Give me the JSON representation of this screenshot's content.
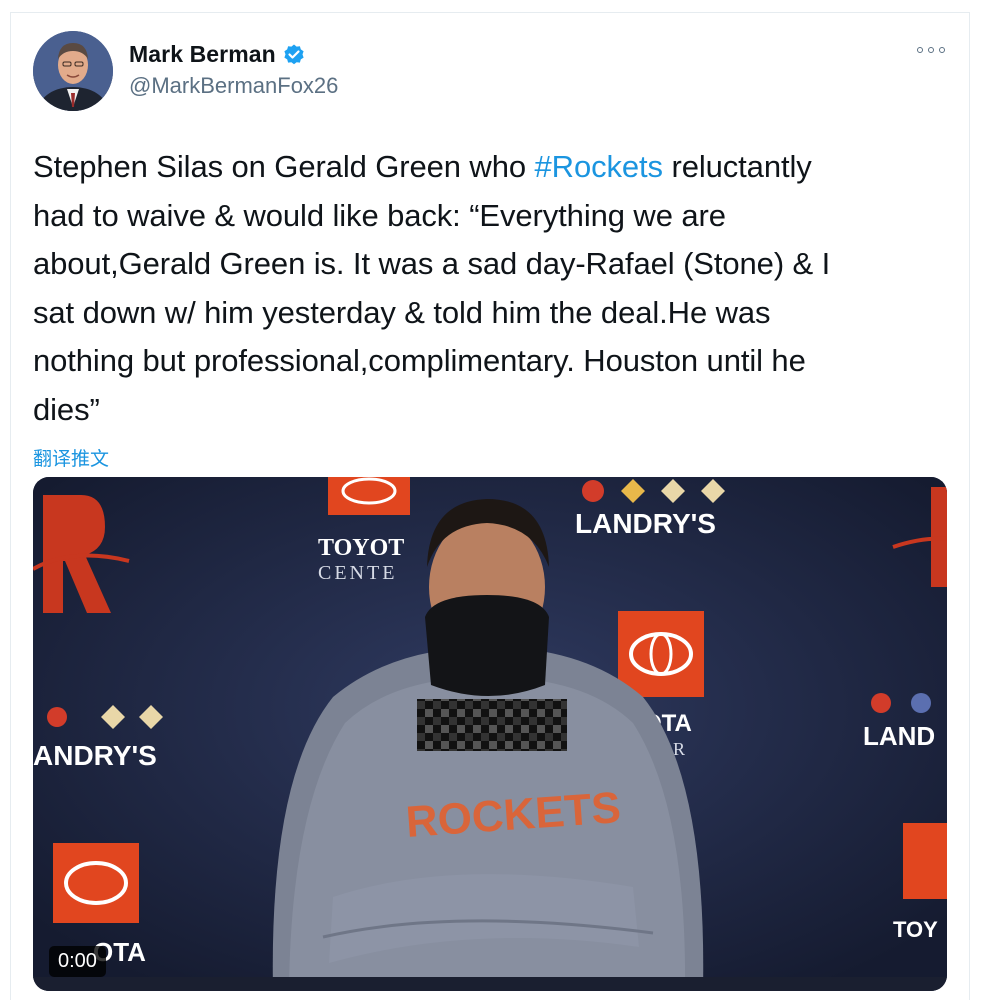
{
  "tweet": {
    "author_name": "Mark Berman",
    "author_handle": "@MarkBermanFox26",
    "text_before": "Stephen Silas on Gerald Green who ",
    "hashtag": "#Rockets",
    "text_after": " reluctantly\nhad to waive & would like back: “Everything we are\nabout,Gerald Green is. It was a sad day-Rafael (Stone) & I\nsat down w/ him yesterday & told him the deal.He was\nnothing but professional,complimentary. Houston until he\ndies”",
    "translate_label": "翻译推文",
    "video_time": "0:00"
  },
  "colors": {
    "link": "#1b95e0",
    "verified": "#1da1f2",
    "secondary_text": "#5b7083"
  },
  "media": {
    "backdrop_texts": [
      "TOYOTA",
      "CENTER",
      "LANDRY'S",
      "ROCKETS"
    ]
  },
  "icons": {
    "verified": "verified-badge-icon",
    "more": "more-options-icon"
  }
}
